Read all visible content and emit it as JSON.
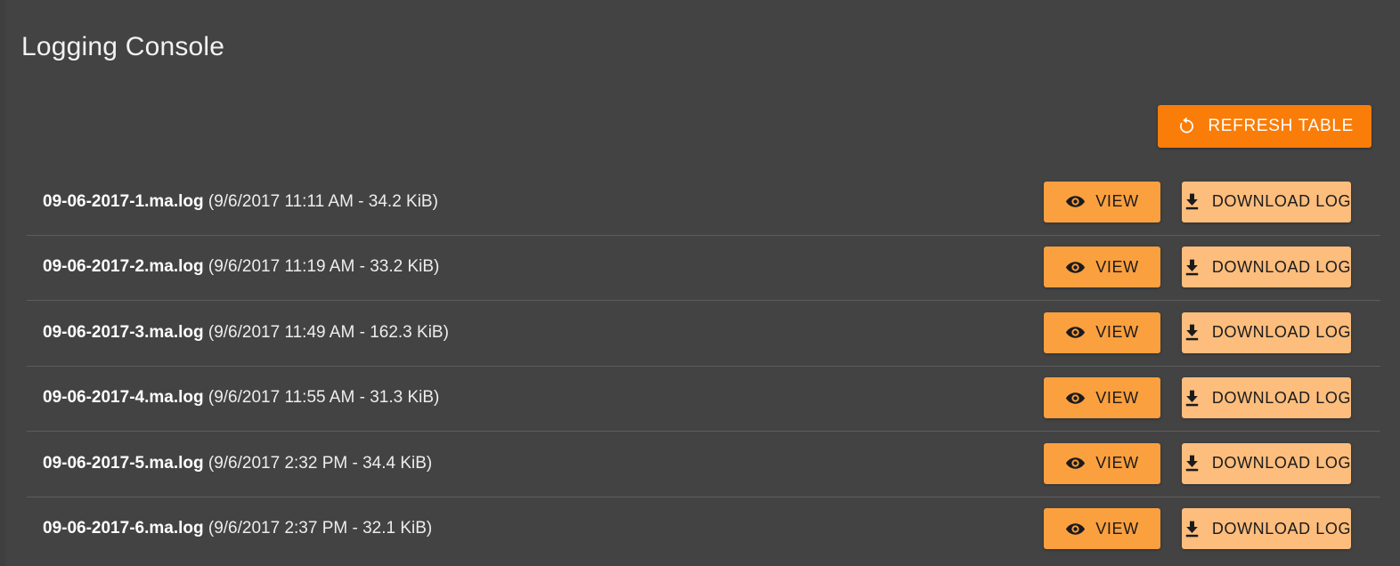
{
  "panel": {
    "title": "Logging Console"
  },
  "toolbar": {
    "refresh_label": "REFRESH TABLE",
    "refresh_icon": "refresh-circular-arrow-icon"
  },
  "actions": {
    "view_label": "VIEW",
    "view_icon": "eye-icon",
    "download_label": "DOWNLOAD LOG",
    "download_icon": "download-arrow-icon"
  },
  "colors": {
    "background": "#434343",
    "panel_edge": "#3f3f3f",
    "divider": "#5d5d5d",
    "refresh_button": "#f97d08",
    "view_button": "#fba03f",
    "download_button": "#fcbd7d",
    "title_text": "#f2f2f2",
    "row_text": "#f0f0f0",
    "button_dark_text": "#1b1b1b"
  },
  "rows": [
    {
      "filename": "09-06-2017-1.ma.log",
      "meta": "(9/6/2017 11:11 AM - 34.2 KiB)",
      "date": "9/6/2017",
      "time": "11:11 AM",
      "size": "34.2 KiB"
    },
    {
      "filename": "09-06-2017-2.ma.log",
      "meta": "(9/6/2017 11:19 AM - 33.2 KiB)",
      "date": "9/6/2017",
      "time": "11:19 AM",
      "size": "33.2 KiB"
    },
    {
      "filename": "09-06-2017-3.ma.log",
      "meta": "(9/6/2017 11:49 AM - 162.3 KiB)",
      "date": "9/6/2017",
      "time": "11:49 AM",
      "size": "162.3 KiB"
    },
    {
      "filename": "09-06-2017-4.ma.log",
      "meta": "(9/6/2017 11:55 AM - 31.3 KiB)",
      "date": "9/6/2017",
      "time": "11:55 AM",
      "size": "31.3 KiB"
    },
    {
      "filename": "09-06-2017-5.ma.log",
      "meta": "(9/6/2017 2:32 PM - 34.4 KiB)",
      "date": "9/6/2017",
      "time": "2:32 PM",
      "size": "34.4 KiB"
    },
    {
      "filename": "09-06-2017-6.ma.log",
      "meta": "(9/6/2017 2:37 PM - 32.1 KiB)",
      "date": "9/6/2017",
      "time": "2:37 PM",
      "size": "32.1 KiB"
    }
  ]
}
